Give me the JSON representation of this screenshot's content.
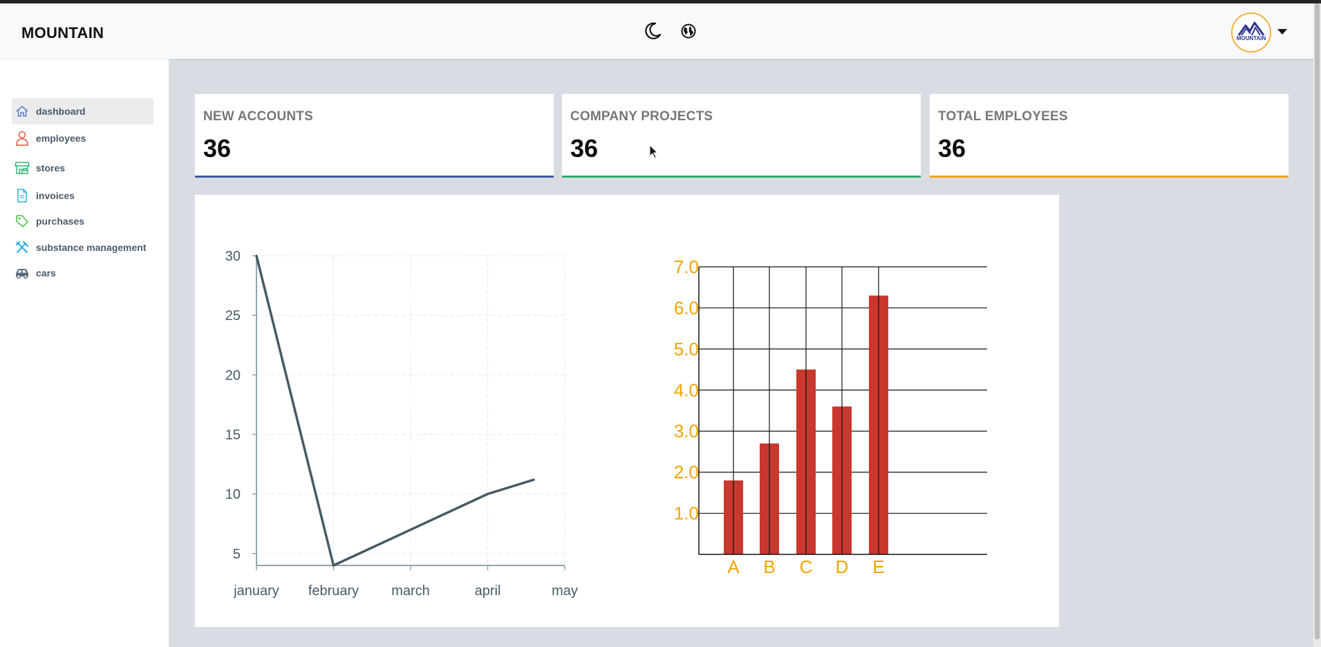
{
  "app": {
    "brand": "MOUNTAIN",
    "avatar_text": "MOUNTAIN"
  },
  "header": {
    "icons": [
      "moon-icon",
      "globe-icon"
    ]
  },
  "sidebar": {
    "items": [
      {
        "label": "dashboard",
        "icon": "home-icon",
        "color": "#5b7cc9"
      },
      {
        "label": "employees",
        "icon": "user-icon",
        "color": "#e2573a"
      },
      {
        "label": "stores",
        "icon": "store-icon",
        "color": "#2bb673"
      },
      {
        "label": "invoices",
        "icon": "document-icon",
        "color": "#27b5d9"
      },
      {
        "label": "purchases",
        "icon": "tag-icon",
        "color": "#3dbd3d"
      },
      {
        "label": "substance management",
        "icon": "tools-icon",
        "color": "#27a9e1"
      },
      {
        "label": "cars",
        "icon": "car-icon",
        "color": "#5d6b7a"
      }
    ]
  },
  "cards": [
    {
      "title": "NEW ACCOUNTS",
      "value": "36",
      "accent": "#3a5a9b"
    },
    {
      "title": "COMPANY PROJECTS",
      "value": "36",
      "accent": "#2eaa6a"
    },
    {
      "title": "TOTAL EMPLOYEES",
      "value": "36",
      "accent": "#f0a420"
    }
  ],
  "chart_data": [
    {
      "type": "line",
      "categories": [
        "january",
        "february",
        "march",
        "april",
        "may"
      ],
      "x": [
        0,
        1,
        2,
        3,
        3.6
      ],
      "values": [
        30,
        4,
        7,
        10,
        11.2
      ],
      "yticks": [
        5,
        10,
        15,
        20,
        25,
        30
      ],
      "ylim": [
        4,
        30
      ],
      "grid": true,
      "line_color": "#455a64",
      "axis_color": "#90a4ae",
      "label_color": "#455a64"
    },
    {
      "type": "bar",
      "categories": [
        "A",
        "B",
        "C",
        "D",
        "E"
      ],
      "values": [
        1.8,
        2.7,
        4.5,
        3.6,
        6.3
      ],
      "yticks": [
        "1.0",
        "2.0",
        "3.0",
        "4.0",
        "5.0",
        "6.0",
        "7.0"
      ],
      "ylim": [
        0,
        7
      ],
      "grid": true,
      "bar_color": "#c8382e",
      "label_color": "#f4a300"
    }
  ]
}
